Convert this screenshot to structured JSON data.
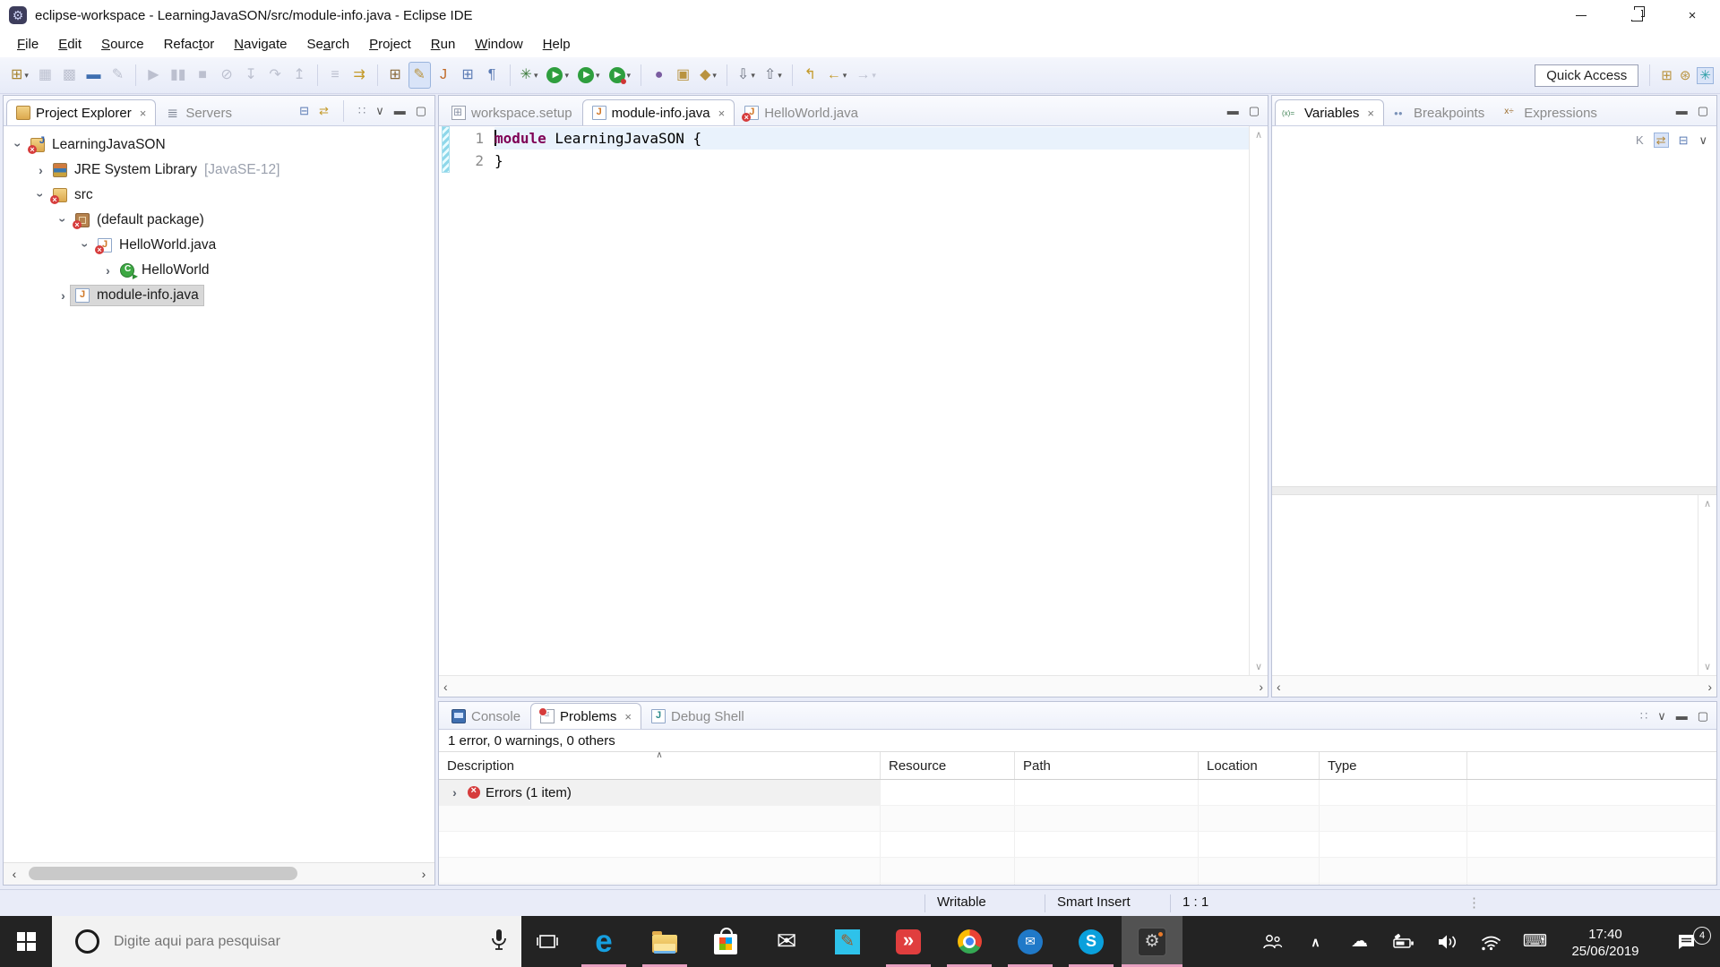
{
  "colors": {
    "keyword": "#7f0055",
    "error_red": "#d63c3c",
    "taskbar_underline": "#e79fc0",
    "toolbar_bg": "#e9ecf8",
    "selection_gray": "#d8d8d8"
  },
  "window": {
    "title": "eclipse-workspace - LearningJavaSON/src/module-info.java - Eclipse IDE"
  },
  "menu": {
    "items": [
      {
        "label": "File",
        "mnemonic": 0
      },
      {
        "label": "Edit",
        "mnemonic": 0
      },
      {
        "label": "Source",
        "mnemonic": 0
      },
      {
        "label": "Refactor",
        "mnemonic": 5
      },
      {
        "label": "Navigate",
        "mnemonic": 0
      },
      {
        "label": "Search",
        "mnemonic": 2
      },
      {
        "label": "Project",
        "mnemonic": 0
      },
      {
        "label": "Run",
        "mnemonic": 0
      },
      {
        "label": "Window",
        "mnemonic": 0
      },
      {
        "label": "Help",
        "mnemonic": 0
      }
    ]
  },
  "toolbar": {
    "quick_access": "Quick Access",
    "items": [
      {
        "name": "new-wizard",
        "glyph": "⊞",
        "color": "#a8842f",
        "dropdown": true
      },
      {
        "name": "save",
        "glyph": "▦",
        "disabled": true
      },
      {
        "name": "save-all",
        "glyph": "▩",
        "disabled": true
      },
      {
        "name": "open-console",
        "glyph": "▬",
        "color": "#3f6fb0"
      },
      {
        "name": "print",
        "glyph": "✎",
        "disabled": true
      },
      {
        "sep": true
      },
      {
        "name": "resume",
        "glyph": "▶",
        "disabled": true
      },
      {
        "name": "suspend",
        "glyph": "▮▮",
        "disabled": true
      },
      {
        "name": "terminate",
        "glyph": "■",
        "disabled": true
      },
      {
        "name": "disconnect",
        "glyph": "⊘",
        "disabled": true
      },
      {
        "name": "step-into",
        "glyph": "↧",
        "disabled": true
      },
      {
        "name": "step-over",
        "glyph": "↷",
        "disabled": true
      },
      {
        "name": "step-return",
        "glyph": "↥",
        "disabled": true
      },
      {
        "sep": true
      },
      {
        "name": "use-step-filters",
        "glyph": "≡",
        "disabled": true
      },
      {
        "name": "run-last-launched",
        "glyph": "⇉",
        "color": "#c49a2a"
      },
      {
        "sep": true
      },
      {
        "name": "new-java-project",
        "glyph": "⊞",
        "color": "#8a6a3a"
      },
      {
        "name": "toggle-mark-occurrences",
        "glyph": "✎",
        "color": "#b8923c",
        "active": true
      },
      {
        "name": "new-java-class",
        "glyph": "J",
        "color": "#c06a28"
      },
      {
        "name": "open-type",
        "glyph": "⊞",
        "color": "#5b7bb4"
      },
      {
        "name": "show-whitespace",
        "glyph": "¶",
        "color": "#5b7bb4"
      },
      {
        "sep": true
      },
      {
        "name": "debug",
        "glyph": "✳",
        "color": "#3f7d3f",
        "dropdown": true
      },
      {
        "name": "run",
        "glyph": "▶",
        "circle": "green",
        "dropdown": true
      },
      {
        "name": "coverage",
        "glyph": "▶",
        "circle": "green",
        "dropdown": true
      },
      {
        "name": "profile",
        "glyph": "▶",
        "circle": "greenred",
        "dropdown": true
      },
      {
        "sep": true
      },
      {
        "name": "new-web-service",
        "glyph": "●",
        "color": "#7a5ca0"
      },
      {
        "name": "open-task",
        "glyph": "▣",
        "color": "#b99340"
      },
      {
        "name": "pin-editor",
        "glyph": "◆",
        "color": "#b99340",
        "dropdown": true
      },
      {
        "sep": true
      },
      {
        "name": "next-annotation",
        "glyph": "⇩",
        "color": "#6a707e",
        "dropdown": true
      },
      {
        "name": "previous-annotation",
        "glyph": "⇧",
        "color": "#6a707e",
        "dropdown": true
      },
      {
        "sep": true
      },
      {
        "name": "last-edit-location",
        "glyph": "↰",
        "color": "#c49a2a"
      },
      {
        "name": "back",
        "glyph": "←",
        "color": "#c49a2a",
        "dropdown": true
      },
      {
        "name": "forward",
        "glyph": "→",
        "disabled": true,
        "dropdown": true
      }
    ],
    "perspectives": [
      {
        "name": "open-perspective",
        "glyph": "⊞",
        "color": "#b8923c"
      },
      {
        "name": "jee-perspective",
        "glyph": "⊛",
        "color": "#b8923c"
      },
      {
        "name": "java-perspective",
        "glyph": "✳",
        "color": "#2e9ea6",
        "active": true
      }
    ]
  },
  "project_explorer": {
    "tabs": [
      {
        "label": "Project Explorer",
        "icon": "project-explorer",
        "active": true,
        "closable": true
      },
      {
        "label": "Servers",
        "icon": "servers"
      }
    ],
    "toolbar_icons": [
      {
        "name": "collapse-all",
        "glyph": "⊟",
        "color": "#5b7bb4"
      },
      {
        "name": "link-with-editor",
        "glyph": "⇄",
        "color": "#c49a2a"
      },
      {
        "sep": true
      },
      {
        "name": "focus",
        "glyph": "∷",
        "color": "#8a8f9c"
      },
      {
        "name": "view-menu",
        "glyph": "∨",
        "color": "#555"
      },
      {
        "name": "minimize",
        "glyph": "▬",
        "color": "#555"
      },
      {
        "name": "maximize",
        "glyph": "▢",
        "color": "#555"
      }
    ],
    "tree": [
      {
        "label": "LearningJavaSON",
        "level": 0,
        "twisty": "expanded",
        "icon": "java-project",
        "error": true
      },
      {
        "label": "JRE System Library",
        "suffix": " [JavaSE-12]",
        "level": 1,
        "twisty": "collapsed",
        "icon": "jre-library"
      },
      {
        "label": "src",
        "level": 1,
        "twisty": "expanded",
        "icon": "source-folder",
        "error": true
      },
      {
        "label": "(default package)",
        "level": 2,
        "twisty": "expanded",
        "icon": "package",
        "error": true
      },
      {
        "label": "HelloWorld.java",
        "level": 3,
        "twisty": "expanded",
        "icon": "java-file",
        "error": true
      },
      {
        "label": "HelloWorld",
        "level": 4,
        "twisty": "collapsed",
        "icon": "class-runnable"
      },
      {
        "label": "module-info.java",
        "level": 2,
        "twisty": "collapsed",
        "icon": "module-file",
        "selected": true
      }
    ]
  },
  "editor": {
    "tabs": [
      {
        "label": "workspace.setup",
        "icon": "setup-file"
      },
      {
        "label": "module-info.java",
        "icon": "module-file",
        "active": true,
        "closable": true
      },
      {
        "label": "HelloWorld.java",
        "icon": "java-file-error"
      }
    ],
    "window_icons": [
      {
        "name": "minimize",
        "glyph": "▬",
        "color": "#555"
      },
      {
        "name": "maximize",
        "glyph": "▢",
        "color": "#555"
      }
    ],
    "lines": [
      {
        "number": "1",
        "current": true,
        "tokens": [
          {
            "type": "keyword",
            "text": "module"
          },
          {
            "type": "plain",
            "text": " LearningJavaSON {"
          }
        ]
      },
      {
        "number": "2",
        "tokens": [
          {
            "type": "plain",
            "text": "}"
          }
        ]
      }
    ]
  },
  "debug_panel": {
    "tabs": [
      {
        "label": "Variables",
        "icon": "variables",
        "active": true,
        "closable": true
      },
      {
        "label": "Breakpoints",
        "icon": "breakpoints"
      },
      {
        "label": "Expressions",
        "icon": "expressions"
      }
    ],
    "window_icons": [
      {
        "name": "minimize",
        "glyph": "▬",
        "color": "#555"
      },
      {
        "name": "maximize",
        "glyph": "▢",
        "color": "#555"
      }
    ],
    "toolbar_icons": [
      {
        "name": "show-type-names",
        "glyph": "K",
        "color": "#8a8f9c"
      },
      {
        "name": "show-logical-structures",
        "glyph": "⇄",
        "color": "#b58a3c",
        "active": true
      },
      {
        "name": "collapse-all",
        "glyph": "⊟",
        "color": "#5b7bb4"
      },
      {
        "name": "view-menu",
        "glyph": "∨",
        "color": "#555"
      }
    ]
  },
  "bottom_panel": {
    "tabs": [
      {
        "label": "Console",
        "icon": "console"
      },
      {
        "label": "Problems",
        "icon": "problems",
        "active": true,
        "closable": true
      },
      {
        "label": "Debug Shell",
        "icon": "debug-shell"
      }
    ],
    "toolbar_icons": [
      {
        "name": "focus",
        "glyph": "∷",
        "color": "#8a8f9c"
      },
      {
        "name": "view-menu",
        "glyph": "∨",
        "color": "#555"
      },
      {
        "name": "minimize",
        "glyph": "▬",
        "color": "#555"
      },
      {
        "name": "maximize",
        "glyph": "▢",
        "color": "#555"
      }
    ],
    "summary": "1 error, 0 warnings, 0 others",
    "table": {
      "columns": [
        {
          "label": "Description",
          "sorted": true
        },
        {
          "label": "Resource"
        },
        {
          "label": "Path"
        },
        {
          "label": "Location"
        },
        {
          "label": "Type"
        }
      ],
      "rows": [
        {
          "description": "Errors (1 item)",
          "icon": "error-circle",
          "twisty": "collapsed"
        }
      ],
      "empty_row_count": 4
    }
  },
  "status_bar": {
    "writable": "Writable",
    "insert_mode": "Smart Insert",
    "caret_position": "1 : 1"
  },
  "taskbar": {
    "search": {
      "placeholder": "Digite aqui para pesquisar"
    },
    "apps": [
      {
        "name": "edge",
        "running": true
      },
      {
        "name": "file-explorer",
        "running": true
      },
      {
        "name": "store"
      },
      {
        "name": "mail"
      },
      {
        "name": "drawing-app"
      },
      {
        "name": "red-diamond-app",
        "running": true
      },
      {
        "name": "chrome",
        "running": true
      },
      {
        "name": "thunderbird",
        "running": true
      },
      {
        "name": "skype",
        "running": true
      },
      {
        "name": "eclipse",
        "running": true,
        "active": true
      }
    ],
    "tray": [
      {
        "name": "people",
        "type": "svg"
      },
      {
        "name": "hidden-icons-chevron",
        "type": "glyph",
        "glyph": "∧"
      },
      {
        "name": "onedrive",
        "type": "glyph",
        "glyph": "☁"
      },
      {
        "name": "battery",
        "type": "svg"
      },
      {
        "name": "volume",
        "type": "svg"
      },
      {
        "name": "network",
        "type": "svg"
      },
      {
        "name": "touch-keyboard",
        "type": "glyph",
        "glyph": "⌨"
      }
    ],
    "clock": {
      "time": "17:40",
      "date": "25/06/2019"
    },
    "notifications": {
      "count": "4"
    }
  }
}
